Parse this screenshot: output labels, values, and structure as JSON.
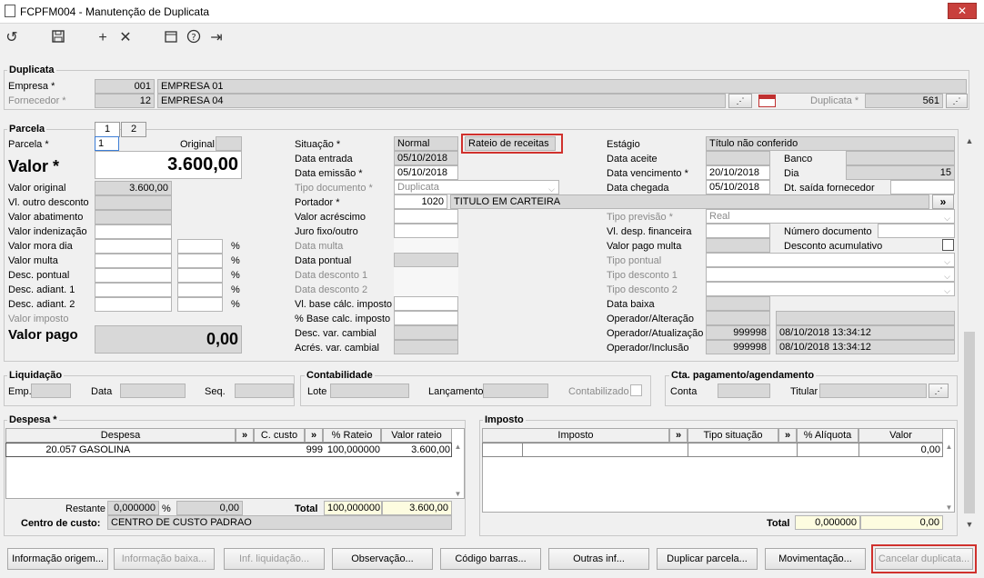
{
  "window": {
    "title": "FCPFM004 - Manutenção de Duplicata",
    "close": "✕"
  },
  "duplicata": {
    "title": "Duplicata",
    "empresa_label": "Empresa *",
    "empresa_code": "001",
    "empresa_name": "EMPRESA 01",
    "fornecedor_label": "Fornecedor *",
    "fornecedor_code": "12",
    "fornecedor_name": "EMPRESA 04",
    "duplicata_label": "Duplicata *",
    "duplicata_value": "561"
  },
  "parcela": {
    "title": "Parcela",
    "tab1": "1",
    "tab2": "2",
    "parcela_label": "Parcela *",
    "parcela_value": "1",
    "original_label": "Original",
    "valor_label": "Valor *",
    "valor_value": "3.600,00",
    "valor_original_label": "Valor original",
    "valor_original_value": "3.600,00",
    "vl_outro_desconto": "Vl. outro desconto",
    "valor_abatimento": "Valor abatimento",
    "valor_indenizacao": "Valor indenização",
    "valor_mora_dia": "Valor mora dia",
    "valor_multa": "Valor multa",
    "desc_pontual": "Desc. pontual",
    "desc_adiant1": "Desc. adiant. 1",
    "desc_adiant2": "Desc. adiant. 2",
    "valor_imposto": "Valor imposto",
    "valor_pago_label": "Valor pago",
    "valor_pago_value": "0,00",
    "pct": "%"
  },
  "mid": {
    "situacao_label": "Situação *",
    "situacao_value": "Normal",
    "rateio_value": "Rateio de receitas",
    "data_entrada_label": "Data entrada",
    "data_entrada_value": "05/10/2018",
    "data_emissao_label": "Data emissão *",
    "data_emissao_value": "05/10/2018",
    "tipo_documento_label": "Tipo documento *",
    "tipo_documento_value": "Duplicata",
    "portador_label": "Portador *",
    "portador_code": "1020",
    "portador_name": "TITULO EM CARTEIRA",
    "valor_acrescimo": "Valor acréscimo",
    "juro_fixo": "Juro fixo/outro",
    "data_multa": "Data multa",
    "data_pontual": "Data pontual",
    "data_desconto1": "Data desconto 1",
    "data_desconto2": "Data desconto 2",
    "vl_base_calc": "Vl. base cálc. imposto",
    "pct_base_calc": "% Base calc. imposto",
    "desc_var_cambial": "Desc. var. cambial",
    "acres_var_cambial": "Acrés. var. cambial"
  },
  "right": {
    "estagio_label": "Estágio",
    "estagio_value": "Título não conferido",
    "data_aceite": "Data aceite",
    "banco_label": "Banco",
    "data_vencimento_label": "Data vencimento *",
    "data_vencimento_value": "20/10/2018",
    "dia_label": "Dia",
    "dia_value": "15",
    "data_chegada_label": "Data chegada",
    "data_chegada_value": "05/10/2018",
    "dt_saida_label": "Dt. saída fornecedor",
    "tipo_previsao_label": "Tipo previsão *",
    "tipo_previsao_value": "Real",
    "vl_desp_financeira": "Vl. desp. financeira",
    "numero_documento": "Número documento",
    "valor_pago_multa": "Valor pago multa",
    "desconto_acumulativo": "Desconto acumulativo",
    "tipo_pontual": "Tipo pontual",
    "tipo_desconto1": "Tipo desconto 1",
    "tipo_desconto2": "Tipo desconto 2",
    "data_baixa": "Data baixa",
    "operador_alteracao": "Operador/Alteração",
    "operador_atualizacao": "Operador/Atualização",
    "operador_atualizacao_code": "999998",
    "operador_atualizacao_date": "08/10/2018 13:34:12",
    "operador_inclusao": "Operador/Inclusão",
    "operador_inclusao_code": "999998",
    "operador_inclusao_date": "08/10/2018 13:34:12"
  },
  "liquidacao": {
    "title": "Liquidação",
    "emp": "Emp.",
    "data": "Data",
    "seq": "Seq."
  },
  "contabilidade": {
    "title": "Contabilidade",
    "lote": "Lote",
    "lancamento": "Lançamento",
    "contabilizado": "Contabilizado"
  },
  "cta": {
    "title": "Cta. pagamento/agendamento",
    "conta": "Conta",
    "titular": "Titular"
  },
  "despesa": {
    "title": "Despesa *",
    "col_despesa": "Despesa",
    "col_ccusto": "C. custo",
    "col_rateio": "% Rateio",
    "col_valor": "Valor rateio",
    "rows": [
      {
        "code": "20.057",
        "name": "GASOLINA",
        "ccusto": "999",
        "rateio": "100,000000",
        "valor": "3.600,00"
      }
    ],
    "restante_label": "Restante",
    "restante_pct": "0,000000",
    "restante_valor": "0,00",
    "total_label": "Total",
    "total_pct": "100,000000",
    "total_valor": "3.600,00",
    "centro_label": "Centro de custo:",
    "centro_value": "CENTRO DE CUSTO PADRAO"
  },
  "imposto": {
    "title": "Imposto",
    "col_imposto": "Imposto",
    "col_tipo": "Tipo situação",
    "col_aliquota": "% Alíquota",
    "col_valor": "Valor",
    "row_valor": "0,00",
    "total_label": "Total",
    "total_pct": "0,000000",
    "total_valor": "0,00"
  },
  "buttons": {
    "info_origem": "Informação origem...",
    "info_baixa": "Informação baixa...",
    "inf_liquidacao": "Inf. liquidação...",
    "observacao": "Observação...",
    "codigo_barras": "Código barras...",
    "outras_inf": "Outras inf...",
    "duplicar": "Duplicar parcela...",
    "movimentacao": "Movimentação...",
    "cancelar": "Cancelar duplicata..."
  },
  "colors": {
    "highlight": "#d0312d",
    "readonly": "#d8d8d8",
    "total_fill": "#fdfce0"
  }
}
